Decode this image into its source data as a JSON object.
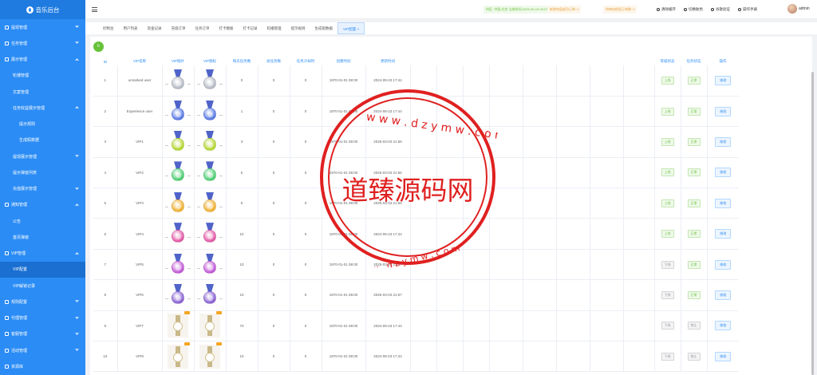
{
  "app_title": "音乐后台",
  "sidebar": {
    "items": [
      {
        "label": "提现管理",
        "level": 0,
        "arrow": "down"
      },
      {
        "label": "任务管理",
        "level": 0,
        "arrow": "down"
      },
      {
        "label": "展示管理",
        "level": 0,
        "arrow": "up"
      },
      {
        "label": "轮播管理",
        "level": 1
      },
      {
        "label": "文案管理",
        "level": 1
      },
      {
        "label": "任务收益展示管理",
        "level": 1,
        "arrow": "up"
      },
      {
        "label": "提示规则",
        "level": 2
      },
      {
        "label": "生成假数据",
        "level": 2
      },
      {
        "label": "提现展示管理",
        "level": 1,
        "arrow": "down"
      },
      {
        "label": "提示弹窗列表",
        "level": 1
      },
      {
        "label": "充值展示管理",
        "level": 1,
        "arrow": "down"
      },
      {
        "label": "通知管理",
        "level": 0,
        "arrow": "up"
      },
      {
        "label": "公告",
        "level": 1
      },
      {
        "label": "首页弹窗",
        "level": 1
      },
      {
        "label": "VIP管理",
        "level": 0,
        "arrow": "up"
      },
      {
        "label": "VIP配置",
        "level": 1,
        "active": true
      },
      {
        "label": "VIP解锁记录",
        "level": 1
      },
      {
        "label": "规则配置",
        "level": 0,
        "arrow": "down"
      },
      {
        "label": "代理管理",
        "level": 0,
        "arrow": "down"
      },
      {
        "label": "客服管理",
        "level": 0,
        "arrow": "down"
      },
      {
        "label": "活动管理",
        "level": 0,
        "arrow": "down"
      },
      {
        "label": "资源库",
        "level": 0
      }
    ]
  },
  "topbar": {
    "status_1": "时区: 中国-北京  当前时间:2025-06-18 09:27",
    "status_2": "新增充值成功订单: 0",
    "status_3": "待审核提现订单数: 0",
    "tools": [
      "清除缓存",
      "切换肤色",
      "谷歌验证",
      "操作手册"
    ],
    "user": "admin"
  },
  "tabs": [
    "控制台",
    "用户列表",
    "资金记录",
    "充值订单",
    "任务订单",
    "打卡模板",
    "打卡记录",
    "轮播管理",
    "提示规则",
    "生成假数据",
    "VIP配置"
  ],
  "active_tab_index": 10,
  "table": {
    "headers": [
      "ID",
      "VIP名称",
      "VIP图片",
      "VIP图标",
      "每天任务数",
      "总任务数",
      "任务冷却时",
      "创建时间",
      "更新时间",
      "",
      "",
      "",
      "",
      "",
      "",
      "",
      "",
      "等级状态",
      "任务状态",
      "操作"
    ],
    "rows": [
      {
        "id": "1",
        "name": "unranked user",
        "task_day": "0",
        "task_total": "0",
        "cool": "0",
        "created": "1970-01-01 08:00",
        "updated": "2024-09-23 17:44",
        "level_status": "上线",
        "task_status": "正常",
        "action": "修改",
        "medal": "silver"
      },
      {
        "id": "2",
        "name": "Experience user",
        "task_day": "1",
        "task_total": "0",
        "cool": "0",
        "created": "1970-01-01 08:00",
        "updated": "2024-09-23 17:44",
        "level_status": "上线",
        "task_status": "正常",
        "action": "修改",
        "medal": "blue"
      },
      {
        "id": "3",
        "name": "VIP1",
        "task_day": "3",
        "task_total": "0",
        "cool": "0",
        "created": "1970-01-01 08:00",
        "updated": "2025-03-03 21:55",
        "level_status": "上线",
        "task_status": "正常",
        "action": "修改",
        "medal": "lime"
      },
      {
        "id": "4",
        "name": "VIP2",
        "task_day": "5",
        "task_total": "0",
        "cool": "0",
        "created": "1970-01-01 08:00",
        "updated": "2025-03-03 21:55",
        "level_status": "上线",
        "task_status": "正常",
        "action": "修改",
        "medal": "green"
      },
      {
        "id": "5",
        "name": "VIP3",
        "task_day": "5",
        "task_total": "0",
        "cool": "0",
        "created": "1970-01-01 08:00",
        "updated": "2025-03-03 21:56",
        "level_status": "上线",
        "task_status": "正常",
        "action": "修改",
        "medal": "gold"
      },
      {
        "id": "6",
        "name": "VIP4",
        "task_day": "10",
        "task_total": "0",
        "cool": "0",
        "created": "1970-01-01 08:00",
        "updated": "2024-09-23 17:44",
        "level_status": "上线",
        "task_status": "正常",
        "action": "修改",
        "medal": "pink"
      },
      {
        "id": "7",
        "name": "VIP5",
        "task_day": "10",
        "task_total": "0",
        "cool": "0",
        "created": "1970-01-01 08:00",
        "updated": "2025-03-03 21:57",
        "level_status": "下线",
        "task_status": "正常",
        "action": "修改",
        "medal": "violet"
      },
      {
        "id": "8",
        "name": "VIP6",
        "task_day": "10",
        "task_total": "0",
        "cool": "0",
        "created": "1970-01-01 08:00",
        "updated": "2025-03-03 21:57",
        "level_status": "下线",
        "task_status": "正常",
        "action": "修改",
        "medal": "purple"
      },
      {
        "id": "9",
        "name": "VIP7",
        "task_day": "70",
        "task_total": "0",
        "cool": "0",
        "created": "1970-01-01 08:00",
        "updated": "2024-09-23 17:44",
        "level_status": "下线",
        "task_status": "禁止",
        "action": "修改",
        "medal": "watch"
      },
      {
        "id": "10",
        "name": "VIP8",
        "task_day": "10",
        "task_total": "0",
        "cool": "0",
        "created": "1970-01-01 08:00",
        "updated": "2024-09-23 17:44",
        "level_status": "下线",
        "task_status": "禁止",
        "action": "修改",
        "medal": "watch"
      }
    ]
  },
  "medal_colors": {
    "silver": "#b8bcc6",
    "blue": "#5b7be6",
    "lime": "#b6d833",
    "green": "#4fcf74",
    "gold": "#f2b233",
    "pink": "#e45aa8",
    "violet": "#c45ad8",
    "purple": "#8b63d6"
  },
  "watermark": {
    "text": "道臻源码网",
    "url_top": "w w w . d z y m w . c o m",
    "url_bottom": "w w w . d z y m w . c o m"
  }
}
